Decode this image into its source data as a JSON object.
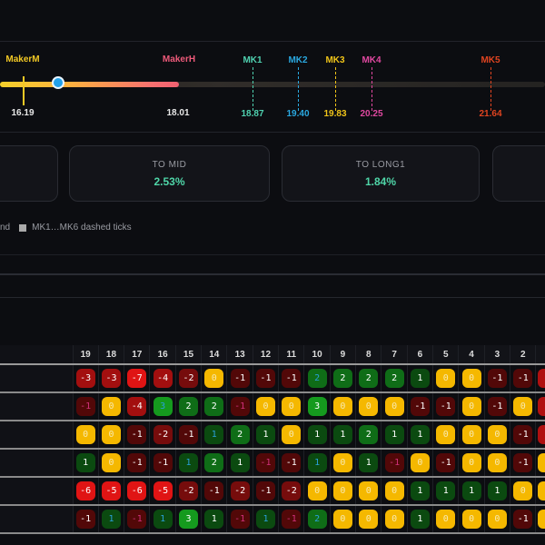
{
  "gauge": {
    "makers": [
      {
        "label": "MakerM",
        "value": "16.19",
        "color": "#f2c825"
      },
      {
        "label": "MakerH",
        "value": "18.01",
        "color": "#ee5a7a"
      }
    ],
    "ticks": [
      {
        "label": "MK1",
        "value": "18.87",
        "color": "#4fd1b0"
      },
      {
        "label": "MK2",
        "value": "19.40",
        "color": "#2aa8e0"
      },
      {
        "label": "MK3",
        "value": "19.83",
        "color": "#f0c419"
      },
      {
        "label": "MK4",
        "value": "20.25",
        "color": "#e048a0"
      },
      {
        "label": "MK5",
        "value": "21.64",
        "color": "#e04420"
      }
    ]
  },
  "cards": [
    {
      "title": "TO MID",
      "value": "2.53%"
    },
    {
      "title": "TO LONG1",
      "value": "1.84%"
    }
  ],
  "legend": {
    "partial": "nd",
    "ticks": "MK1…MK6 dashed ticks"
  },
  "table": {
    "columns": [
      "19",
      "18",
      "17",
      "16",
      "15",
      "14",
      "13",
      "12",
      "11",
      "10",
      "9",
      "8",
      "7",
      "6",
      "5",
      "4",
      "3",
      "2"
    ],
    "rows": [
      {
        "cells": [
          -3,
          -3,
          -7,
          -4,
          -2,
          0,
          -1,
          -1,
          -1,
          2,
          2,
          2,
          2,
          1,
          0,
          0,
          -1,
          -1
        ],
        "muted": [
          9
        ],
        "edge": "neg"
      },
      {
        "cells": [
          -1,
          0,
          -4,
          3,
          2,
          2,
          -1,
          0,
          0,
          3,
          0,
          0,
          0,
          -1,
          -1,
          0,
          -1,
          0
        ],
        "muted": [
          0,
          3,
          6
        ],
        "edge": "neg"
      },
      {
        "cells": [
          0,
          0,
          -1,
          -2,
          -1,
          1,
          2,
          1,
          0,
          1,
          1,
          2,
          1,
          1,
          0,
          0,
          0,
          -1
        ],
        "muted": [
          5
        ],
        "edge": "neg"
      },
      {
        "cells": [
          1,
          0,
          -1,
          -1,
          1,
          2,
          1,
          -1,
          -1,
          1,
          0,
          1,
          -1,
          0,
          -1,
          0,
          0,
          -1
        ],
        "muted": [
          4,
          7,
          9,
          12
        ],
        "edge": "zero"
      },
      {
        "cells": [
          -6,
          -5,
          -6,
          -5,
          -2,
          -1,
          -2,
          -1,
          -2,
          0,
          0,
          0,
          0,
          1,
          1,
          1,
          1,
          0
        ],
        "muted": [],
        "edge": "zero"
      },
      {
        "cells": [
          -1,
          1,
          -1,
          1,
          3,
          1,
          -1,
          1,
          -1,
          2,
          0,
          0,
          0,
          1,
          0,
          0,
          0,
          -1
        ],
        "muted": [
          1,
          2,
          3,
          6,
          7,
          8,
          9
        ],
        "edge": "zero"
      }
    ]
  }
}
